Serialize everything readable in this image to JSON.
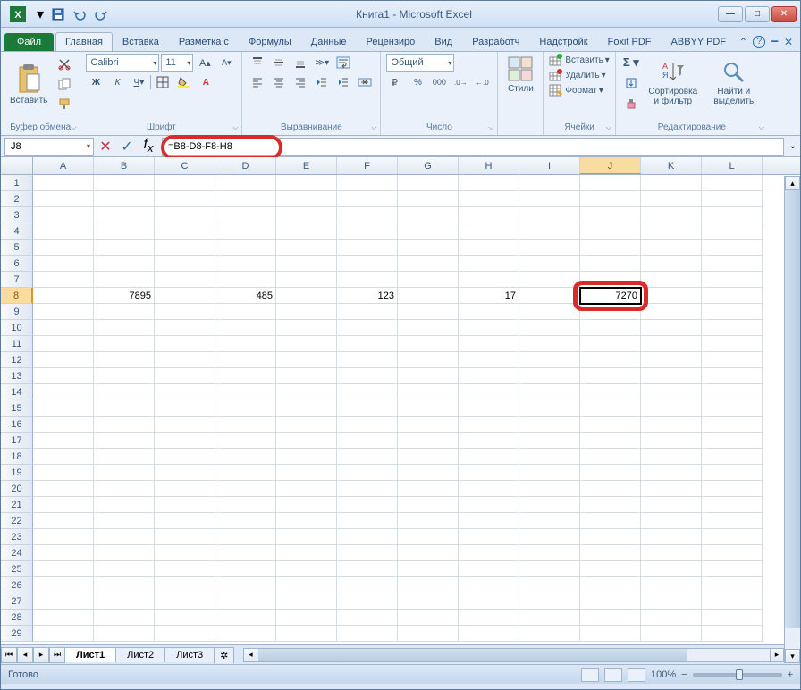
{
  "title": "Книга1 - Microsoft Excel",
  "tabs": {
    "file": "Файл",
    "list": [
      "Главная",
      "Вставка",
      "Разметка с",
      "Формулы",
      "Данные",
      "Рецензиро",
      "Вид",
      "Разработч",
      "Надстройк",
      "Foxit PDF",
      "ABBYY PDF"
    ],
    "active": 0
  },
  "ribbon": {
    "clipboard": {
      "paste": "Вставить",
      "label": "Буфер обмена"
    },
    "font": {
      "name": "Calibri",
      "size": "11",
      "label": "Шрифт"
    },
    "align": {
      "label": "Выравнивание"
    },
    "number": {
      "format": "Общий",
      "label": "Число"
    },
    "styles": {
      "label": "Стили",
      "btn": "Стили"
    },
    "cells": {
      "insert": "Вставить",
      "delete": "Удалить",
      "format": "Формат",
      "label": "Ячейки"
    },
    "editing": {
      "sort": "Сортировка и фильтр",
      "find": "Найти и выделить",
      "label": "Редактирование"
    }
  },
  "nameBox": "J8",
  "formula": "=B8-D8-F8-H8",
  "columns": [
    "A",
    "B",
    "C",
    "D",
    "E",
    "F",
    "G",
    "H",
    "I",
    "J",
    "K",
    "L"
  ],
  "selectedCol": "J",
  "selectedRow": 8,
  "rowCount": 29,
  "cells": {
    "B8": "7895",
    "D8": "485",
    "F8": "123",
    "H8": "17",
    "J8": "7270"
  },
  "sheets": [
    "Лист1",
    "Лист2",
    "Лист3"
  ],
  "activeSheet": 0,
  "status": "Готово",
  "zoom": "100%"
}
